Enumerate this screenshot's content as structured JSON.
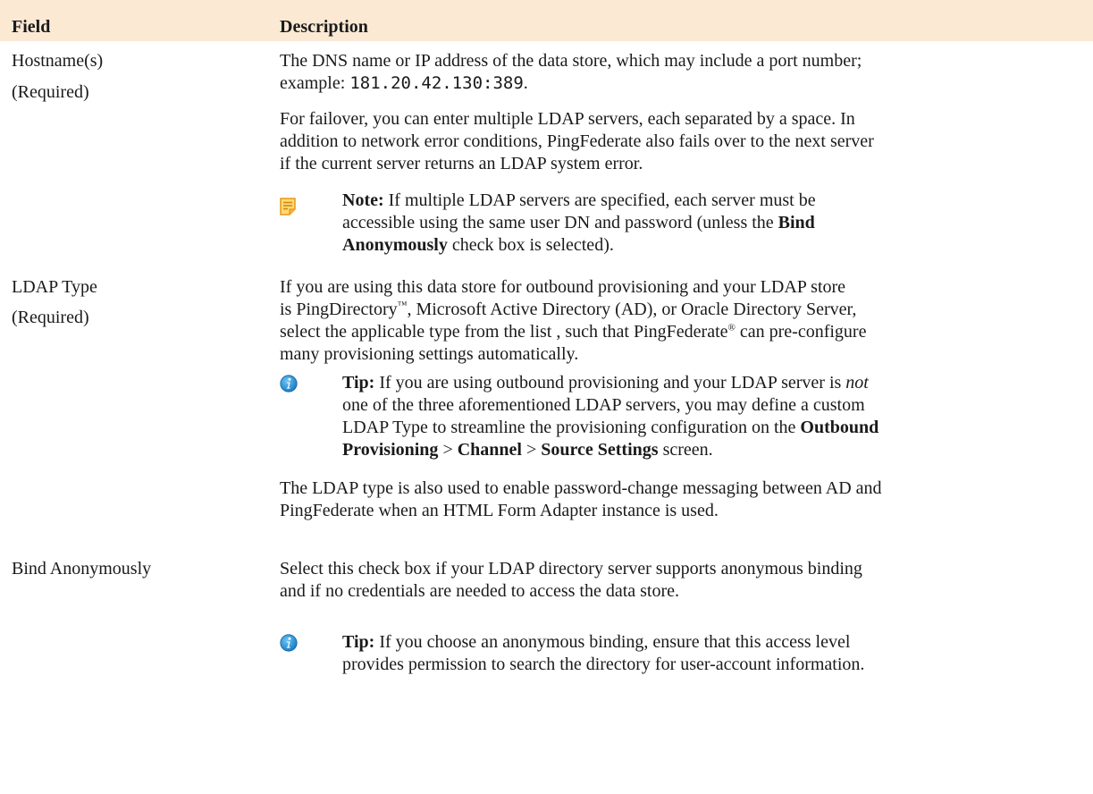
{
  "header": {
    "field_label": "Field",
    "description_label": "Description"
  },
  "rows": [
    {
      "field": "Hostname(s)",
      "required": "(Required)",
      "p1_a": "The DNS name or IP address of the data store, which may include a port number;",
      "p1_b": "example: ",
      "p1_code": "181.20.42.130:389",
      "p1_c": ".",
      "p2_l1": "For failover, you can enter multiple LDAP servers, each separated by a space. In",
      "p2_l2": "addition to network error conditions, PingFederate also fails over to the next server",
      "p2_l3": "if the current server returns an LDAP system error.",
      "note_label": "Note:",
      "note_l1": "  If multiple LDAP servers are specified, each server must be",
      "note_l2": "accessible using the same user DN and password (unless the ",
      "note_bold1": "Bind",
      "note_bold2": "Anonymously",
      "note_l3": " check box is selected)."
    },
    {
      "field": "LDAP Type",
      "required": "(Required)",
      "p1_l1": "If you are using this data store for outbound provisioning and your LDAP store",
      "p1_l2a": "is PingDirectory",
      "tm": "™",
      "p1_l2b": ", Microsoft Active Directory (AD), or Oracle Directory Server,",
      "p1_l3a": "select the applicable type from the list , such that PingFederate",
      "reg": "®",
      "p1_l3b": " can pre-configure",
      "p1_l4": "many provisioning settings automatically.",
      "tip_label": "Tip:",
      "tip_l1a": " If you are using outbound provisioning and your LDAP server is ",
      "tip_not": "not",
      "tip_l2": "one of the three aforementioned LDAP servers, you may define a custom",
      "tip_l3a": "LDAP Type to streamline the provisioning configuration on the ",
      "tip_outbound": "Outbound",
      "tip_provisioning": "Provisioning",
      "tip_sep1": " > ",
      "tip_channel": "Channel",
      "tip_sep2": " > ",
      "tip_source": "Source Settings",
      "tip_l4end": " screen.",
      "p2_l1": "The LDAP type is also used to enable password-change messaging between AD and",
      "p2_l2": "PingFederate when an HTML Form Adapter instance is used."
    },
    {
      "field": "Bind Anonymously",
      "p1_l1": "Select this check box if your LDAP directory server supports anonymous binding",
      "p1_l2": "and if no credentials are needed to access the data store.",
      "tip_label": "Tip:",
      "tip_l1": " If you choose an anonymous binding, ensure that this access level",
      "tip_l2": "provides permission to search the directory for user-account information."
    }
  ],
  "icons": {
    "note": "note-icon",
    "tip": "info-icon"
  },
  "colors": {
    "header_bg": "#fbe9d4",
    "note_icon": "#f2a71b",
    "tip_icon": "#1e8fd6"
  }
}
